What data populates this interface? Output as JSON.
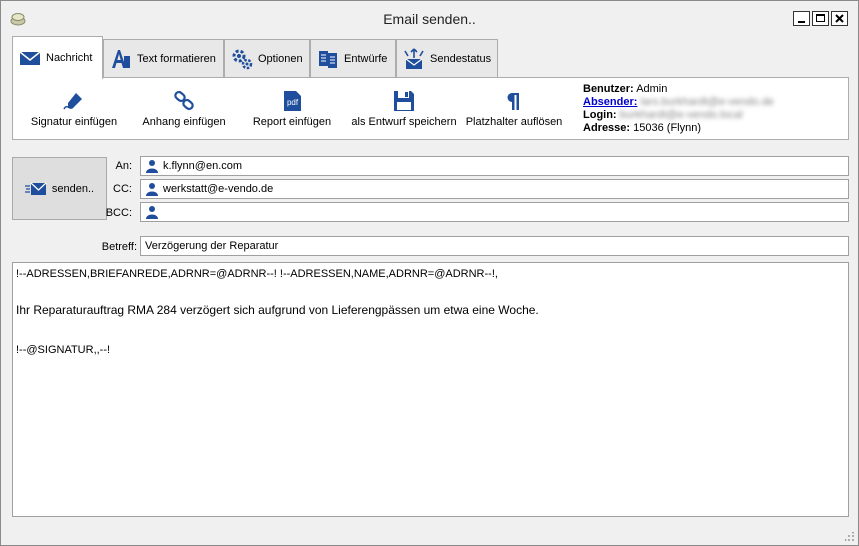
{
  "window": {
    "title": "Email senden.."
  },
  "tabs": [
    {
      "label": "Nachricht",
      "icon": "envelope-icon"
    },
    {
      "label": "Text formatieren",
      "icon": "text-format-icon"
    },
    {
      "label": "Optionen",
      "icon": "gears-icon"
    },
    {
      "label": "Entwürfe",
      "icon": "documents-icon"
    },
    {
      "label": "Sendestatus",
      "icon": "send-status-icon"
    }
  ],
  "toolbar": {
    "signatur": "Signatur einfügen",
    "anhang": "Anhang einfügen",
    "report": "Report einfügen",
    "entwurf": "als Entwurf speichern",
    "platzhalter": "Platzhalter auflösen",
    "pdf_icon_text": "pdf"
  },
  "user_info": {
    "benutzer_label": "Benutzer:",
    "benutzer_value": "Admin",
    "absender_label": "Absender:",
    "absender_value": "lars.burkhardt@e-vendo.de",
    "login_label": "Login:",
    "login_value": "burkhardt@e-vendo.local",
    "adresse_label": "Adresse:",
    "adresse_value": "15036 (Flynn)"
  },
  "send": {
    "label": "senden.."
  },
  "fields": {
    "an_label": "An:",
    "an_value": "k.flynn@en.com",
    "cc_label": "CC:",
    "cc_value": "werkstatt@e-vendo.de",
    "bcc_label": "BCC:",
    "bcc_value": "",
    "betreff_label": "Betreff:",
    "betreff_value": "Verzögerung der Reparatur"
  },
  "body": {
    "line1": "!--ADRESSEN,BRIEFANREDE,ADRNR=@ADRNR--! !--ADRESSEN,NAME,ADRNR=@ADRNR--!,",
    "line2": "Ihr Reparaturauftrag RMA 284 verzögert sich aufgrund von Lieferengpässen um etwa eine Woche.",
    "line3": "!--@SIGNATUR,,--!"
  },
  "colors": {
    "accent_blue": "#1f4e9c",
    "link_blue": "#0000cc"
  }
}
